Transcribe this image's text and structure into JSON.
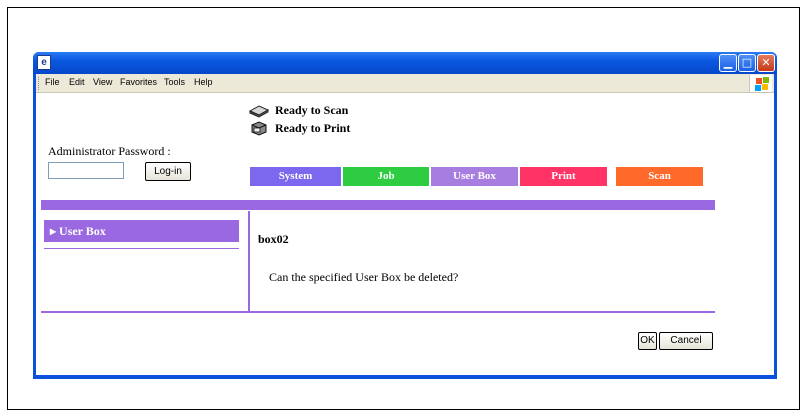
{
  "menu": [
    "File",
    "Edit",
    "View",
    "Favorites",
    "Tools",
    "Help"
  ],
  "status": {
    "scan": "Ready to Scan",
    "print": "Ready to Print"
  },
  "login": {
    "label": "Administrator Password :",
    "password_value": "",
    "button": "Log-in"
  },
  "tabs": [
    {
      "label": "System",
      "color": "#7b68ee"
    },
    {
      "label": "Job",
      "color": "#2ecc40"
    },
    {
      "label": "User Box",
      "color": "#a87de0"
    },
    {
      "label": "Print",
      "color": "#ff3366"
    },
    {
      "label": "Scan",
      "color": "#ff6a2a"
    }
  ],
  "sidebar": {
    "item": "▸ User Box"
  },
  "main": {
    "box_name": "box02",
    "question": "Can the specified User Box be deleted?"
  },
  "buttons": {
    "ok": "OK",
    "cancel": "Cancel"
  },
  "colors": {
    "accent": "#9a68e0",
    "titlebar": "#0a58e0"
  },
  "icons": {
    "scanner": "scanner-icon",
    "printer": "printer-icon"
  }
}
